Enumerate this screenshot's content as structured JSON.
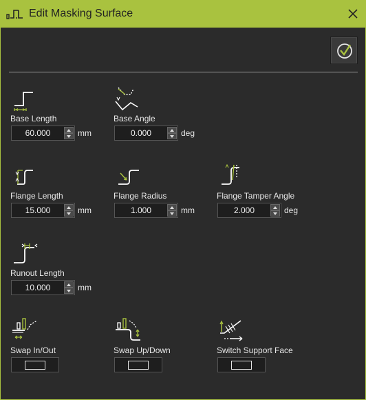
{
  "window": {
    "title": "Edit Masking Surface",
    "accent": "#a9c23f"
  },
  "params": {
    "base_length": {
      "label": "Base Length",
      "value": "60.000",
      "unit": "mm"
    },
    "base_angle": {
      "label": "Base Angle",
      "value": "0.000",
      "unit": "deg"
    },
    "flange_length": {
      "label": "Flange Length",
      "value": "15.000",
      "unit": "mm"
    },
    "flange_radius": {
      "label": "Flange Radius",
      "value": "1.000",
      "unit": "mm"
    },
    "flange_tamper_angle": {
      "label": "Flange Tamper Angle",
      "value": "2.000",
      "unit": "deg"
    },
    "runout_length": {
      "label": "Runout Length",
      "value": "10.000",
      "unit": "mm"
    }
  },
  "toggles": {
    "swap_in_out": {
      "label": "Swap In/Out"
    },
    "swap_up_down": {
      "label": "Swap Up/Down"
    },
    "switch_support_face": {
      "label": "Switch Support Face"
    }
  }
}
